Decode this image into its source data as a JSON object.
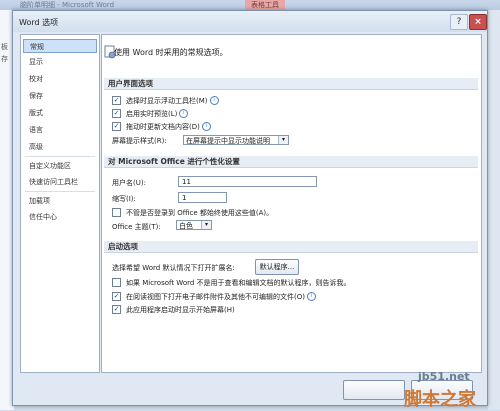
{
  "background_window": {
    "title": "脑阶单明细 - Microsoft Word",
    "contextual_tab": "表格工具",
    "left_fragments": [
      "板",
      "存"
    ]
  },
  "dialog": {
    "title": "Word 选项",
    "help_glyph": "?",
    "close_glyph": "×"
  },
  "nav": {
    "items": [
      "常规",
      "显示",
      "校对",
      "保存",
      "版式",
      "语言",
      "高级",
      "自定义功能区",
      "快速访问工具栏",
      "加载项",
      "信任中心"
    ],
    "selected_index": 0
  },
  "main": {
    "intro": "使用 Word 时采用的常规选项。",
    "ui_section": {
      "title": "用户界面选项",
      "options": [
        {
          "label": "选择时显示浮动工具栏(M)",
          "checked": true
        },
        {
          "label": "启用实时预览(L)",
          "checked": true
        },
        {
          "label": "拖动时更新文档内容(D)",
          "checked": true
        }
      ],
      "screentip_label": "屏幕提示样式(R):",
      "screentip_value": "在屏幕提示中显示功能说明"
    },
    "personalize_section": {
      "title": "对 Microsoft Office 进行个性化设置",
      "username_label": "用户名(U):",
      "username_value": "11",
      "initials_label": "缩写(I):",
      "initials_value": "1",
      "always_use_label": "不管是否登录到 Office 都始终使用这些值(A)。",
      "always_use_checked": false,
      "theme_label": "Office 主题(T):",
      "theme_value": "白色"
    },
    "startup_section": {
      "title": "启动选项",
      "default_ext_label": "选择希望 Word 默认情况下打开扩展名:",
      "default_programs_button": "默认程序...",
      "options": [
        {
          "label": "如果 Microsoft Word 不是用于查看和编辑文档的默认程序，则告诉我。",
          "checked": false
        },
        {
          "label": "在阅读视图下打开电子邮件附件及其他不可编辑的文件(O)",
          "checked": true
        },
        {
          "label": "此应用程序启动时显示开始屏幕(H)",
          "checked": true
        }
      ]
    }
  },
  "watermark": {
    "line1": "jb51.net",
    "line2": "脚本之家"
  }
}
